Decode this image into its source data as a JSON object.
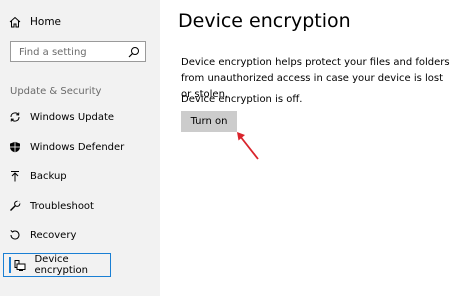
{
  "sidebar": {
    "home_label": "Home",
    "search_placeholder": "Find a setting",
    "section_header": "Update & Security",
    "items": [
      {
        "label": "Windows Update",
        "icon": "refresh-icon"
      },
      {
        "label": "Windows Defender",
        "icon": "shield-icon"
      },
      {
        "label": "Backup",
        "icon": "backup-icon"
      },
      {
        "label": "Troubleshoot",
        "icon": "wrench-icon"
      },
      {
        "label": "Recovery",
        "icon": "recovery-icon"
      },
      {
        "label": "Device encryption",
        "icon": "device-icon",
        "selected": true
      }
    ]
  },
  "main": {
    "title": "Device encryption",
    "description": "Device encryption helps protect your files and folders from unauthorized access in case your device is lost or stolen.",
    "status": "Device encryption is off.",
    "button_label": "Turn on"
  },
  "colors": {
    "sidebar_bg": "#f2f2f2",
    "accent": "#1a7fd4",
    "button_bg": "#cccccc",
    "annotation_arrow": "#d9242c"
  }
}
